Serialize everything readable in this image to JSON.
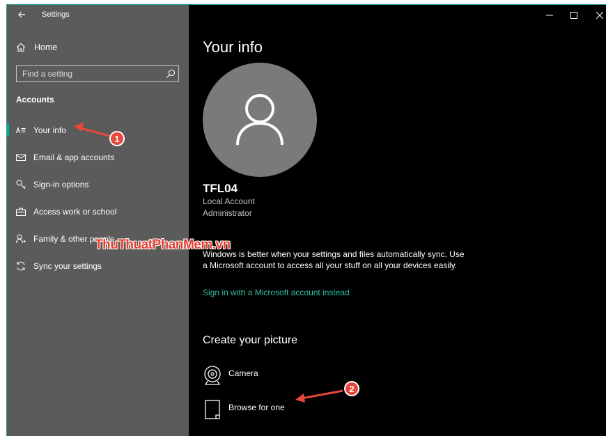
{
  "window": {
    "title": "Settings",
    "controls": [
      "minimize-icon",
      "maximize-icon",
      "close-icon"
    ]
  },
  "sidebar": {
    "home_label": "Home",
    "search": {
      "placeholder": "Find a setting",
      "value": ""
    },
    "section_title": "Accounts",
    "items": [
      {
        "label": "Your info",
        "icon": "person-card-icon",
        "selected": true
      },
      {
        "label": "Email & app accounts",
        "icon": "mail-icon"
      },
      {
        "label": "Sign-in options",
        "icon": "key-icon"
      },
      {
        "label": "Access work or school",
        "icon": "briefcase-icon"
      },
      {
        "label": "Family & other people",
        "icon": "person-add-icon"
      },
      {
        "label": "Sync your settings",
        "icon": "sync-icon"
      }
    ]
  },
  "watermark": "ThuThuatPhanMem.vn",
  "main": {
    "title": "Your info",
    "user": {
      "name": "TFL04",
      "account_type": "Local Account",
      "role": "Administrator"
    },
    "info_text": "Windows is better when your settings and files automatically sync. Use a Microsoft account to access all your stuff on all your devices easily.",
    "link": "Sign in with a Microsoft account instead",
    "create_picture": {
      "title": "Create your picture",
      "options": [
        {
          "label": "Camera",
          "icon": "camera-icon"
        },
        {
          "label": "Browse for one",
          "icon": "browse-file-icon"
        }
      ]
    }
  },
  "annotations": [
    "1",
    "2"
  ],
  "colors": {
    "sidebar_bg": "#5b5b5b",
    "main_bg": "#000000",
    "accent": "#00b294",
    "link": "#2fbf9c",
    "annotation": "#e8473d"
  }
}
